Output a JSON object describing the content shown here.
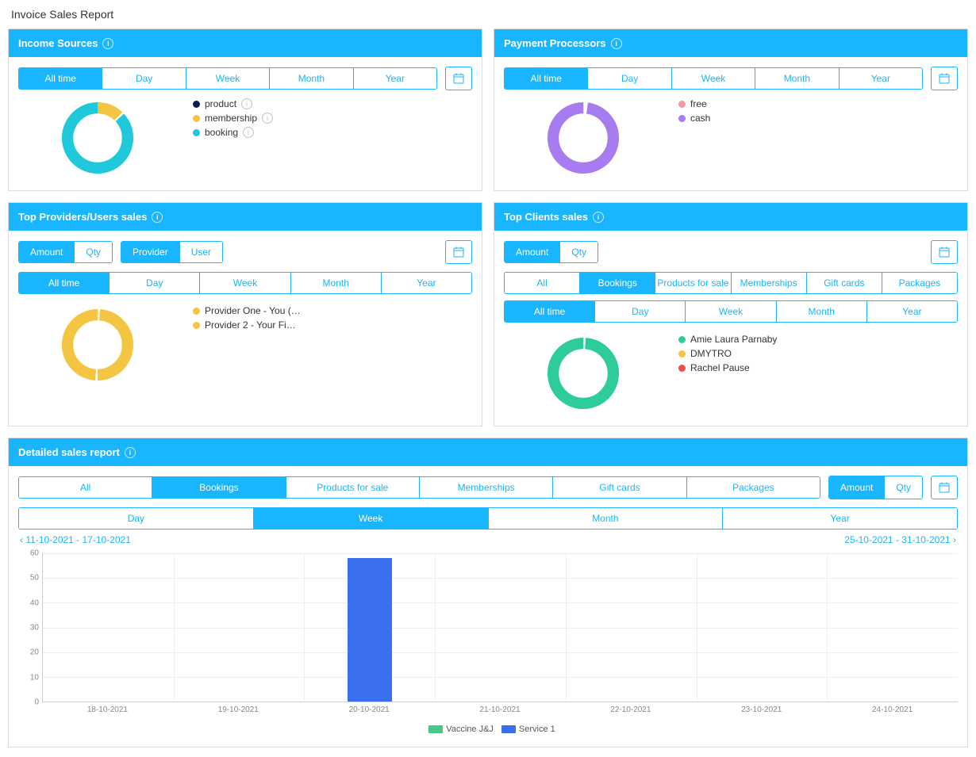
{
  "page_title": "Invoice Sales Report",
  "time_tabs": [
    "All time",
    "Day",
    "Week",
    "Month",
    "Year"
  ],
  "income_sources": {
    "title": "Income Sources",
    "active_tab": 0,
    "legend": [
      {
        "label": "product",
        "color": "#0a1d4e"
      },
      {
        "label": "membership",
        "color": "#f4c542"
      },
      {
        "label": "booking",
        "color": "#1fc8db"
      }
    ],
    "donut": {
      "segments": [
        {
          "color": "#f4c542",
          "from": 0,
          "to": 0.12
        },
        {
          "color": "#1fc8db",
          "from": 0.13,
          "to": 1.0
        }
      ]
    }
  },
  "payment_processors": {
    "title": "Payment Processors",
    "active_tab": 0,
    "legend": [
      {
        "label": "free",
        "color": "#f59aa0"
      },
      {
        "label": "cash",
        "color": "#a77cf0"
      }
    ],
    "donut": {
      "segments": [
        {
          "color": "#a77cf0",
          "from": 0.02,
          "to": 1.0
        }
      ]
    }
  },
  "top_providers": {
    "title": "Top Providers/Users sales",
    "metric_tabs": [
      "Amount",
      "Qty"
    ],
    "metric_active": 0,
    "role_tabs": [
      "Provider",
      "User"
    ],
    "role_active": 0,
    "active_tab": 0,
    "legend": [
      {
        "label": "Provider One - You (…",
        "color": "#f4c542"
      },
      {
        "label": "Provider 2 - Your Fi…",
        "color": "#f4c542"
      }
    ],
    "donut": {
      "segments": [
        {
          "color": "#f4c542",
          "from": 0.01,
          "to": 0.5
        },
        {
          "color": "#f4c542",
          "from": 0.51,
          "to": 1.0
        }
      ]
    }
  },
  "top_clients": {
    "title": "Top Clients sales",
    "metric_tabs": [
      "Amount",
      "Qty"
    ],
    "metric_active": 0,
    "category_tabs": [
      "All",
      "Bookings",
      "Products for sale",
      "Memberships",
      "Gift cards",
      "Packages"
    ],
    "category_active": 1,
    "active_tab": 0,
    "legend": [
      {
        "label": "Amie Laura Parnaby",
        "color": "#2ecc9b"
      },
      {
        "label": "DMYTRO",
        "color": "#f4c542"
      },
      {
        "label": "Rachel Pause",
        "color": "#ef4c4c"
      }
    ],
    "donut": {
      "segments": [
        {
          "color": "#2ecc9b",
          "from": 0.01,
          "to": 1.0
        }
      ]
    }
  },
  "detailed": {
    "title": "Detailed sales report",
    "category_tabs": [
      "All",
      "Bookings",
      "Products for sale",
      "Memberships",
      "Gift cards",
      "Packages"
    ],
    "category_active": 1,
    "metric_tabs": [
      "Amount",
      "Qty"
    ],
    "metric_active": 0,
    "time_tabs": [
      "Day",
      "Week",
      "Month",
      "Year"
    ],
    "time_active": 1,
    "prev_range": "11-10-2021 - 17-10-2021",
    "next_range": "25-10-2021 - 31-10-2021"
  },
  "chart_data": {
    "type": "bar",
    "categories": [
      "18-10-2021",
      "19-10-2021",
      "20-10-2021",
      "21-10-2021",
      "22-10-2021",
      "23-10-2021",
      "24-10-2021"
    ],
    "series": [
      {
        "name": "Vaccine J&J",
        "color": "#4cc78a",
        "values": [
          0,
          0,
          0,
          0,
          0,
          0,
          0
        ]
      },
      {
        "name": "Service 1",
        "color": "#3a6ff0",
        "values": [
          0,
          0,
          58,
          0,
          0,
          0,
          0
        ]
      }
    ],
    "ylim": [
      0,
      60
    ],
    "yticks": [
      0,
      10,
      20,
      30,
      40,
      50,
      60
    ]
  }
}
